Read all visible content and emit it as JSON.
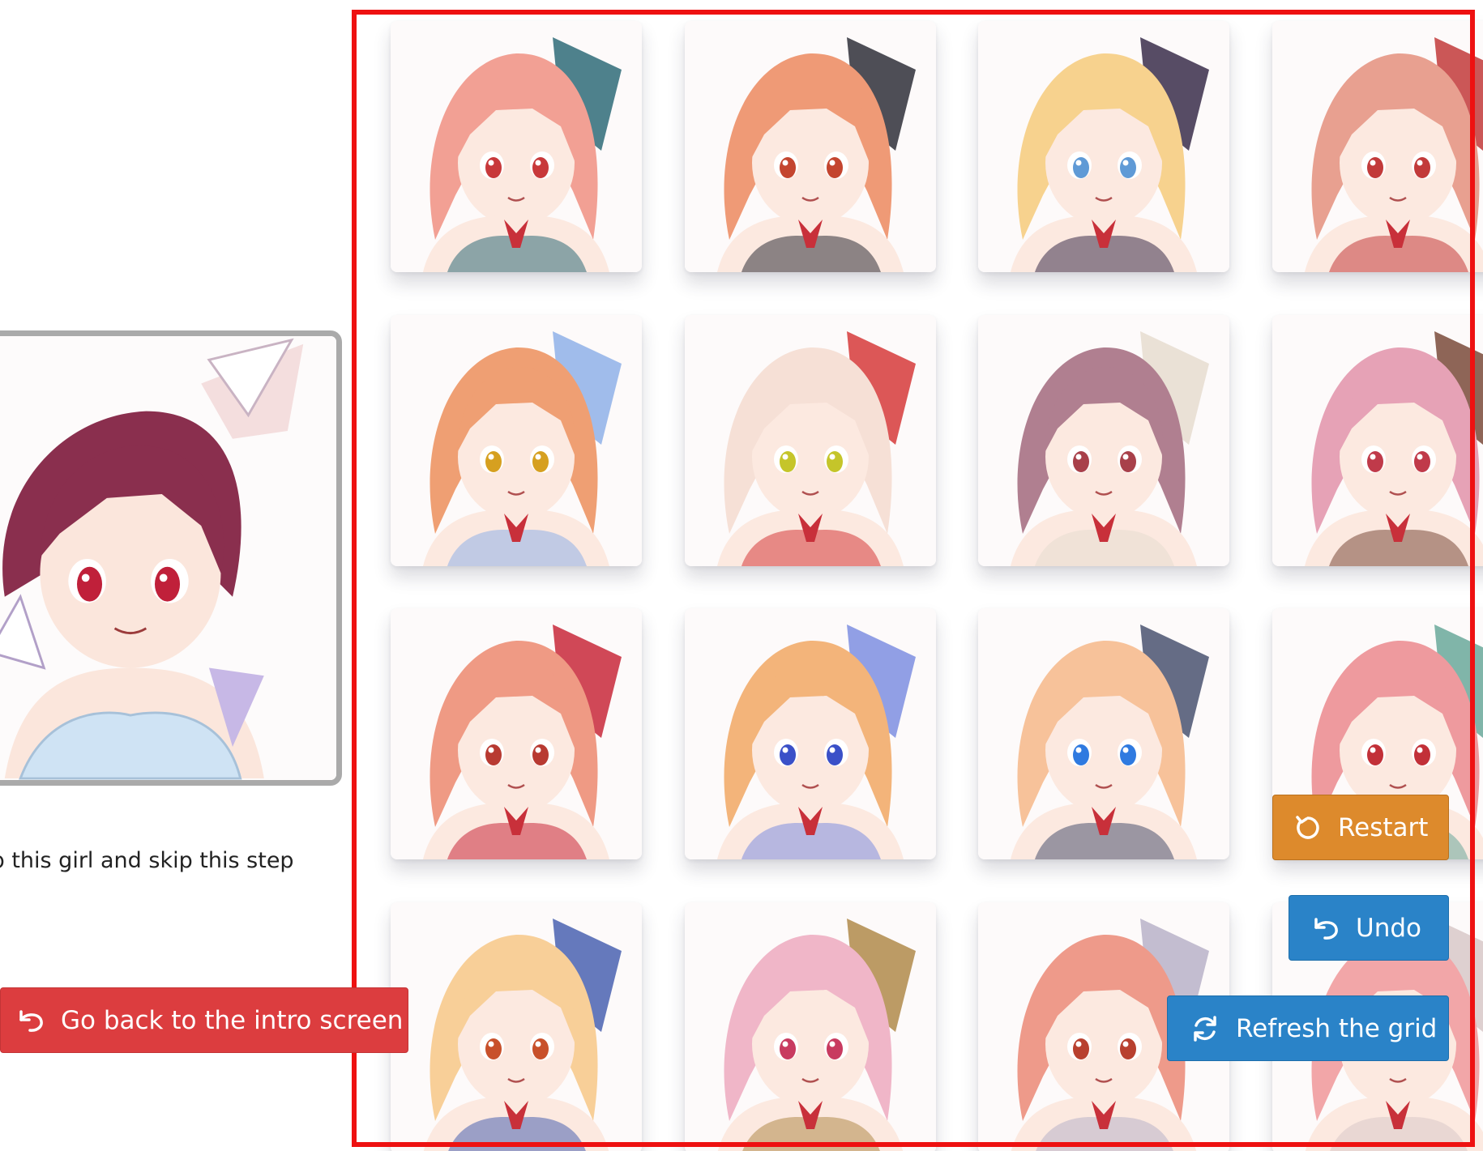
{
  "current_girl": {
    "image": "current-girl-portrait",
    "hair_color": "#8a2f4e",
    "eye_color": "#c0203a"
  },
  "keep_text": "ep this girl and skip this step",
  "buttons": {
    "back": {
      "label": "Go back to the intro screen",
      "icon": "undo-arrow-icon",
      "color": "#dc3d3f"
    },
    "restart": {
      "label": "Restart",
      "icon": "restart-icon",
      "color": "#dd8a2c"
    },
    "undo": {
      "label": "Undo",
      "icon": "undo-arrow-icon",
      "color": "#2a83c8"
    },
    "refresh": {
      "label": "Refresh the grid",
      "icon": "refresh-icon",
      "color": "#2a83c8"
    }
  },
  "grid": {
    "highlight_color": "#ee1111",
    "tiles": [
      {
        "hair": "#f2a094",
        "eyes": "#c8383a",
        "accent": "#2f6b78"
      },
      {
        "hair": "#ef9a76",
        "eyes": "#c4452f",
        "accent": "#2f2f38"
      },
      {
        "hair": "#f7d28e",
        "eyes": "#5f9ad6",
        "accent": "#3a2d4a"
      },
      {
        "hair": "#e8a090",
        "eyes": "#c23a3a",
        "accent": "#c23a3a"
      },
      {
        "hair": "#ef9f73",
        "eyes": "#d6a020",
        "accent": "#8fb0e8"
      },
      {
        "hair": "#f6e0d6",
        "eyes": "#c5c52a",
        "accent": "#d63a3a"
      },
      {
        "hair": "#b07f90",
        "eyes": "#a8404a",
        "accent": "#e6dccf"
      },
      {
        "hair": "#e6a2b6",
        "eyes": "#c03a4a",
        "accent": "#7a4a3a"
      },
      {
        "hair": "#ef9a84",
        "eyes": "#b83a32",
        "accent": "#c8283a"
      },
      {
        "hair": "#f3b47a",
        "eyes": "#3a50c8",
        "accent": "#7e8ee0"
      },
      {
        "hair": "#f7c29a",
        "eyes": "#2f7ae0",
        "accent": "#4a5270"
      },
      {
        "hair": "#ee9a9e",
        "eyes": "#c23038",
        "accent": "#6aa89a"
      },
      {
        "hair": "#f8cf98",
        "eyes": "#c8502a",
        "accent": "#4a62b0"
      },
      {
        "hair": "#f0b6c8",
        "eyes": "#c83a60",
        "accent": "#b08a4a"
      },
      {
        "hair": "#ee9a8a",
        "eyes": "#b8402f",
        "accent": "#b8b2c8"
      },
      {
        "hair": "#f2a6a8",
        "eyes": "#c23a40",
        "accent": "#d8c8c8"
      }
    ]
  }
}
